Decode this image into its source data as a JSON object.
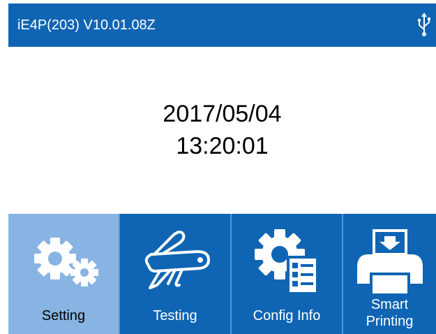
{
  "header": {
    "title": "iE4P(203) V10.01.08Z",
    "status_icon": "usb-icon"
  },
  "clock": {
    "date": "2017/05/04",
    "time": "13:20:01"
  },
  "menu": [
    {
      "label": "Setting",
      "icon": "gears-icon",
      "selected": true
    },
    {
      "label": "Testing",
      "icon": "multitool-icon",
      "selected": false
    },
    {
      "label": "Config Info",
      "icon": "config-list-icon",
      "selected": false
    },
    {
      "label_line1": "Smart",
      "label_line2": "Printing",
      "icon": "printer-icon",
      "selected": false
    }
  ],
  "colors": {
    "primary": "#0f65b3",
    "selected_tile": "#87b4e3",
    "divider": "#4f9ad9",
    "text_on_primary": "#ffffff"
  }
}
